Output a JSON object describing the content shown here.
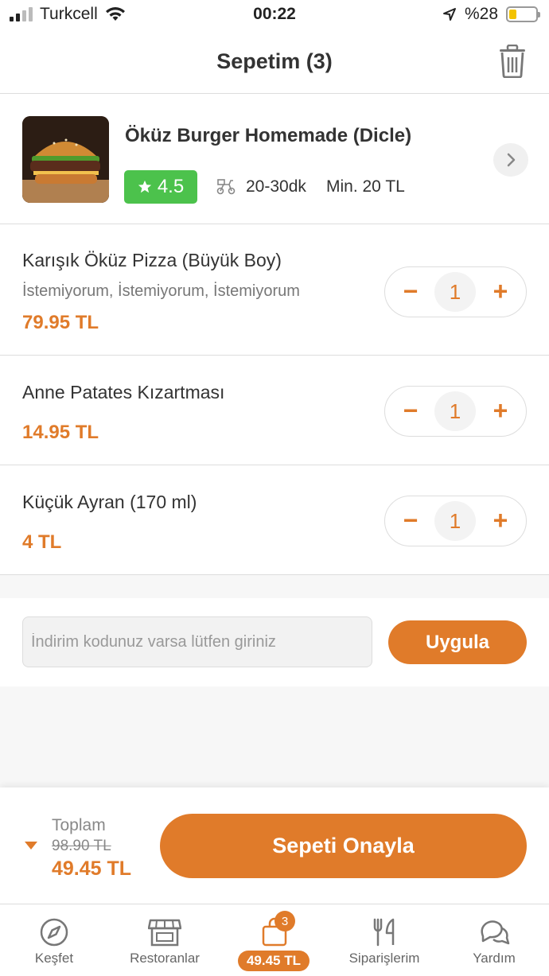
{
  "status_bar": {
    "carrier": "Turkcell",
    "time": "00:22",
    "battery": "%28",
    "battery_level": 0.28
  },
  "header": {
    "title": "Sepetim (3)",
    "trash_icon": "trash-icon"
  },
  "restaurant": {
    "name": "Öküz Burger Homemade (Dicle)",
    "rating": "4.5",
    "delivery_time": "20-30dk",
    "min_order": "Min. 20 TL"
  },
  "items": [
    {
      "name": "Karışık Öküz Pizza (Büyük Boy)",
      "options": "İstemiyorum, İstemiyorum, İstemiyorum",
      "price": "79.95 TL",
      "qty": "1"
    },
    {
      "name": "Anne Patates Kızartması",
      "price": "14.95 TL",
      "qty": "1"
    },
    {
      "name": "Küçük Ayran (170 ml)",
      "price": "4 TL",
      "qty": "1"
    }
  ],
  "stepper": {
    "minus": "−",
    "plus": "+"
  },
  "coupon": {
    "placeholder": "İndirim kodunuz varsa lütfen giriniz",
    "apply_label": "Uygula"
  },
  "footer": {
    "total_label": "Toplam",
    "old_price": "98.90 TL",
    "new_price": "49.45 TL",
    "confirm_label": "Sepeti Onayla"
  },
  "tabbar": {
    "tabs": [
      {
        "label": "Keşfet",
        "icon": "compass-icon"
      },
      {
        "label": "Restoranlar",
        "icon": "storefront-icon"
      },
      {
        "label": "49.45 TL",
        "icon": "shopping-bag-icon",
        "badge": "3"
      },
      {
        "label": "Siparişlerim",
        "icon": "fork-knife-icon"
      },
      {
        "label": "Yardım",
        "icon": "chat-bubbles-icon"
      }
    ]
  },
  "colors": {
    "accent": "#e07b2a",
    "rating_green": "#4cc24c",
    "text": "#333333",
    "muted": "#777777"
  }
}
